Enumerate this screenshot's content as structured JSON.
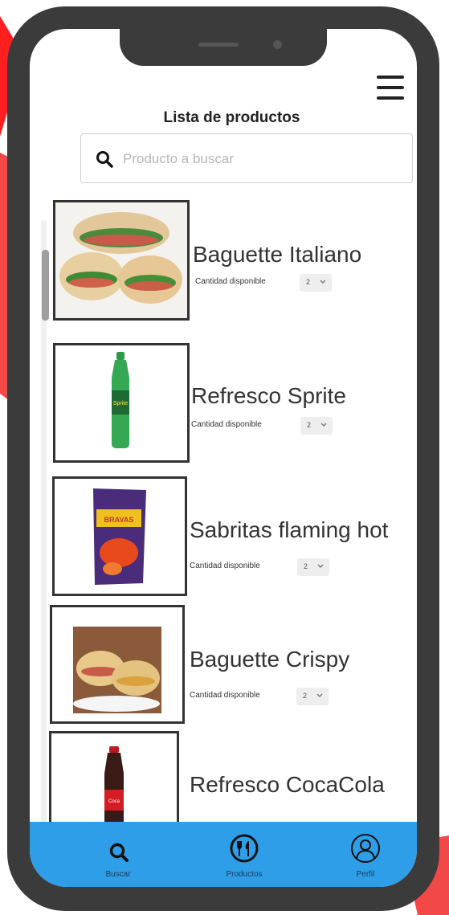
{
  "header": {
    "title": "Lista de productos"
  },
  "search": {
    "placeholder": "Producto a buscar",
    "value": ""
  },
  "products": [
    {
      "name": "Baguette Italiano",
      "quantity_label": "Cantidad disponible",
      "quantity": "2"
    },
    {
      "name": "Refresco Sprite",
      "quantity_label": "Cantidad disponible",
      "quantity": "2"
    },
    {
      "name": "Sabritas flaming hot",
      "quantity_label": "Cantidad disponible",
      "quantity": "2"
    },
    {
      "name": "Baguette Crispy",
      "quantity_label": "Cantidad disponible",
      "quantity": "2"
    },
    {
      "name": "Refresco CocaCola"
    }
  ],
  "bottom_nav": {
    "items": [
      {
        "label": "Buscar",
        "icon": "search-icon"
      },
      {
        "label": "Productos",
        "icon": "fork-knife-icon"
      },
      {
        "label": "Perfil",
        "icon": "user-icon"
      }
    ]
  },
  "colors": {
    "accent": "#2e9ee8",
    "phone_frame": "#3b3b3b",
    "background_shape": "#f03a3a"
  }
}
